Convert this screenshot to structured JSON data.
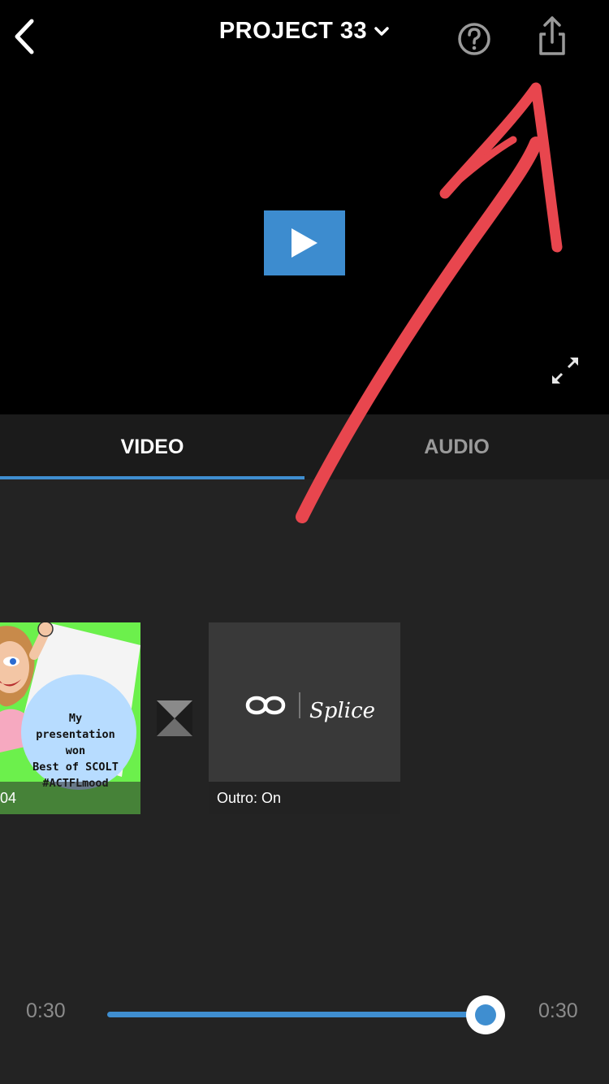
{
  "header": {
    "project_title": "PROJECT 33",
    "back_icon": "chevron-left-icon",
    "title_dropdown_icon": "chevron-down-icon",
    "help_icon": "question-circle-icon",
    "share_icon": "share-icon"
  },
  "player": {
    "play_icon": "play-icon",
    "fullscreen_icon": "expand-icon",
    "play_color": "#3d8ccf"
  },
  "tabs": [
    {
      "label": "VIDEO",
      "active": true
    },
    {
      "label": "AUDIO",
      "active": false
    }
  ],
  "timeline": {
    "clips": [
      {
        "label": "04",
        "thumbnail_text": [
          "My",
          "presentation",
          "won",
          "Best of SCOLT",
          "#ACTFLmood"
        ]
      },
      {
        "label": "Outro: On",
        "logo_text": "Splice"
      }
    ],
    "transition_icon": "hourglass-transition-icon"
  },
  "playback": {
    "current_time": "0:30",
    "total_time": "0:30",
    "progress_fraction": 1.0,
    "accent_color": "#3f8ed0"
  },
  "annotation": {
    "arrow_color": "#e8464e",
    "points_to": "share-button"
  }
}
